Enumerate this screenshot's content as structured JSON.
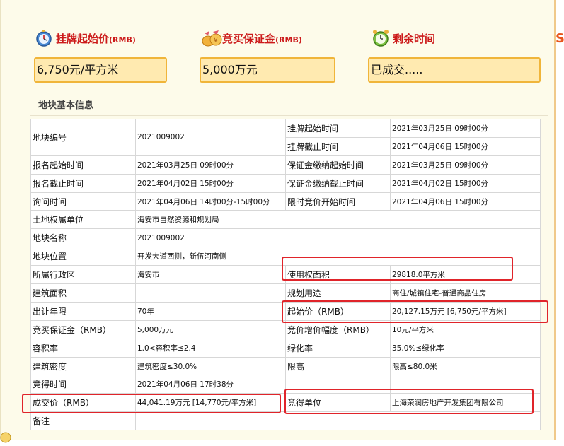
{
  "stats": [
    {
      "label": "挂牌起始价",
      "unit": "(RMB)",
      "icon": "stopwatch-icon",
      "value": "6,750元/平方米"
    },
    {
      "label": "竞买保证金",
      "unit": "(RMB)",
      "icon": "money-bag-icon",
      "value": "5,000万元"
    },
    {
      "label": "剩余时间",
      "unit": "",
      "icon": "alarm-clock-icon",
      "value": "已成交....."
    }
  ],
  "section_title": "地块基本信息",
  "rows": [
    [
      "地块编号",
      "2021009002",
      "挂牌起始时间",
      "2021年03月25日 09时00分"
    ],
    [
      "",
      "",
      "挂牌截止时间",
      "2021年04月06日 15时00分"
    ],
    [
      "报名起始时间",
      "2021年03月25日 09时00分",
      "保证金缴纳起始时间",
      "2021年03月25日 09时00分"
    ],
    [
      "报名截止时间",
      "2021年04月02日 15时00分",
      "保证金缴纳截止时间",
      "2021年04月02日 15时00分"
    ],
    [
      "询问时间",
      "2021年04月06日 14时00分-15时00分",
      "限时竞价开始时间",
      "2021年04月06日 15时00分"
    ],
    [
      "土地权属单位",
      "海安市自然资源和规划局",
      "",
      ""
    ],
    [
      "地块名称",
      "2021009002",
      "",
      ""
    ],
    [
      "地块位置",
      "开发大道西侧，新伍河南侧",
      "",
      ""
    ],
    [
      "所属行政区",
      "海安市",
      "使用权面积",
      "29818.0平方米"
    ],
    [
      "建筑面积",
      "",
      "规划用途",
      "商住/城镇住宅-普通商品住房"
    ],
    [
      "出让年限",
      "70年",
      "起始价（RMB）",
      "20,127.15万元 [6,750元/平方米]"
    ],
    [
      "竞买保证金（RMB）",
      "5,000万元",
      "竞价增价幅度（RMB）",
      "10元/平方米"
    ],
    [
      "容积率",
      "1.0<容积率≤2.4",
      "绿化率",
      "35.0%≤绿化率"
    ],
    [
      "建筑密度",
      "建筑密度≤30.0%",
      "限高",
      "限高≤80.0米"
    ],
    [
      "竞得时间",
      "2021年04月06日 17时38分",
      "",
      ""
    ],
    [
      "成交价（RMB）",
      "44,041.19万元 [14,770元/平方米]",
      "竞得单位",
      "上海荣润房地产开发集团有限公司"
    ],
    [
      "备注",
      "",
      "",
      ""
    ]
  ],
  "colors": {
    "accent": "#cc1a1a",
    "box_fill": "#ffeab0",
    "box_border": "#f0b53a",
    "highlight": "#e0242a",
    "panel_bg": "#fdfbea"
  }
}
